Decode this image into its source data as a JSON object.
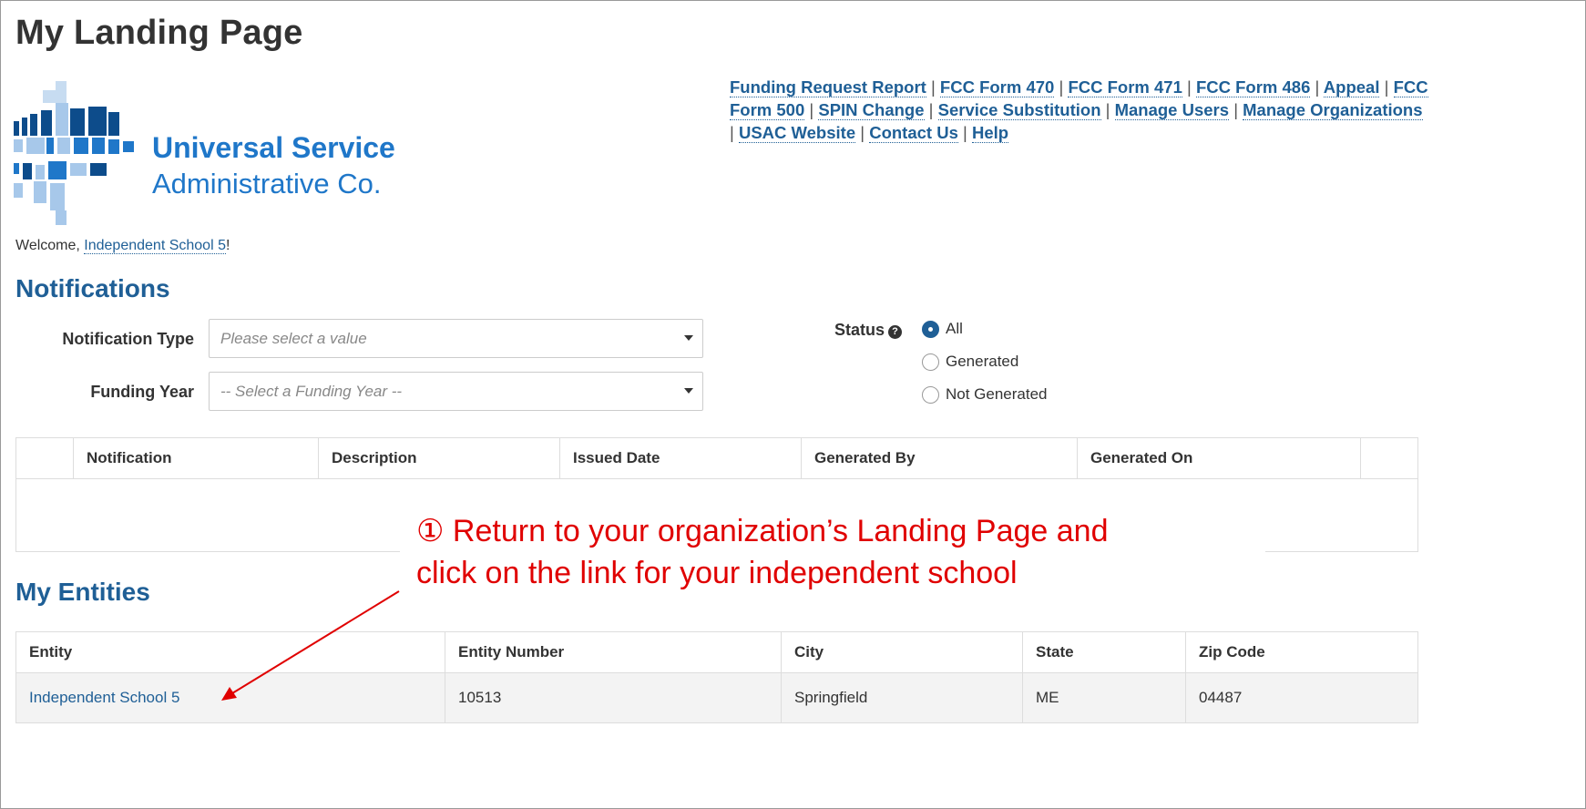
{
  "page": {
    "title": "My Landing Page"
  },
  "logo": {
    "name": "Universal Service",
    "sub": "Administrative Co.",
    "color": "#1f77c9"
  },
  "nav": {
    "links": [
      "Funding Request Report",
      "FCC Form 470",
      "FCC Form 471",
      "FCC Form 486",
      "Appeal",
      "FCC Form 500",
      "SPIN Change",
      "Service Substitution",
      "Manage Users",
      "Manage Organizations",
      "USAC Website",
      "Contact Us",
      "Help"
    ],
    "separator": "|"
  },
  "welcome": {
    "prefix": "Welcome, ",
    "user": "Independent School 5",
    "suffix": "!"
  },
  "notifications": {
    "heading": "Notifications",
    "type_label": "Notification Type",
    "type_placeholder": "Please select a value",
    "year_label": "Funding Year",
    "year_placeholder": "-- Select a Funding Year --",
    "status_label": "Status",
    "status_options": [
      "All",
      "Generated",
      "Not Generated"
    ],
    "status_selected": "All",
    "columns": [
      "",
      "Notification",
      "Description",
      "Issued Date",
      "Generated By",
      "Generated On",
      ""
    ]
  },
  "entities": {
    "heading": "My Entities",
    "columns": [
      "Entity",
      "Entity Number",
      "City",
      "State",
      "Zip Code"
    ],
    "rows": [
      {
        "entity": "Independent School 5",
        "number": "10513",
        "city": "Springfield",
        "state": "ME",
        "zip": "04487"
      }
    ]
  },
  "callout": {
    "marker": "①",
    "line1": " Return to your organization’s Landing Page and",
    "line2": "click on the link for your independent school",
    "color": "#e00000"
  },
  "colors": {
    "link": "#1f5f96",
    "heading": "#1f5f96",
    "annotation": "#e00000"
  }
}
